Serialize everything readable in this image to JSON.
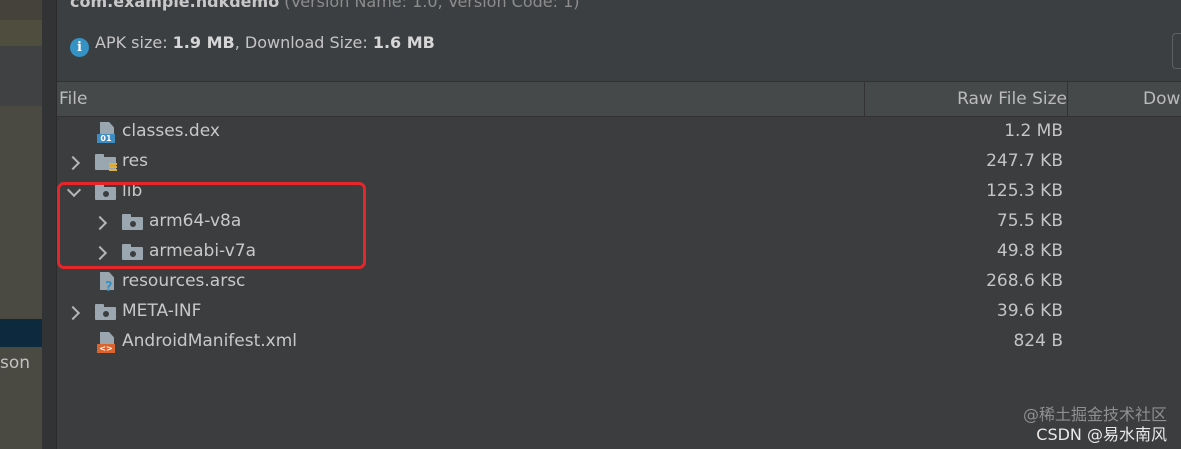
{
  "left_panel": {
    "partial_text": "son"
  },
  "header": {
    "package": "com.example.ndkdemo",
    "version_info": "(Version Name: 1.0, Version Code: 1)"
  },
  "size_info": {
    "apk_label": "APK size: ",
    "apk_value": "1.9 MB",
    "download_label": ", Download Size: ",
    "download_value": "1.6 MB"
  },
  "columns": {
    "file": "File",
    "raw": "Raw File Size",
    "download": "Dow"
  },
  "rows": [
    {
      "name": "classes.dex",
      "size": "1.2 MB",
      "icon": "dex-file-icon"
    },
    {
      "name": "res",
      "size": "247.7 KB",
      "icon": "folder-res-icon"
    },
    {
      "name": "lib",
      "size": "125.3 KB",
      "icon": "folder-icon"
    },
    {
      "name": "arm64-v8a",
      "size": "75.5 KB",
      "icon": "folder-icon"
    },
    {
      "name": "armeabi-v7a",
      "size": "49.8 KB",
      "icon": "folder-icon"
    },
    {
      "name": "resources.arsc",
      "size": "268.6 KB",
      "icon": "resource-file-icon"
    },
    {
      "name": "META-INF",
      "size": "39.6 KB",
      "icon": "folder-icon"
    },
    {
      "name": "AndroidManifest.xml",
      "size": "824 B",
      "icon": "xml-file-icon"
    }
  ],
  "watermark": {
    "line1": "@稀土掘金技术社区",
    "line2": "CSDN @易水南风"
  },
  "colors": {
    "highlight": "#e5262a",
    "info": "#3592c4",
    "selection": "#0d293e"
  }
}
